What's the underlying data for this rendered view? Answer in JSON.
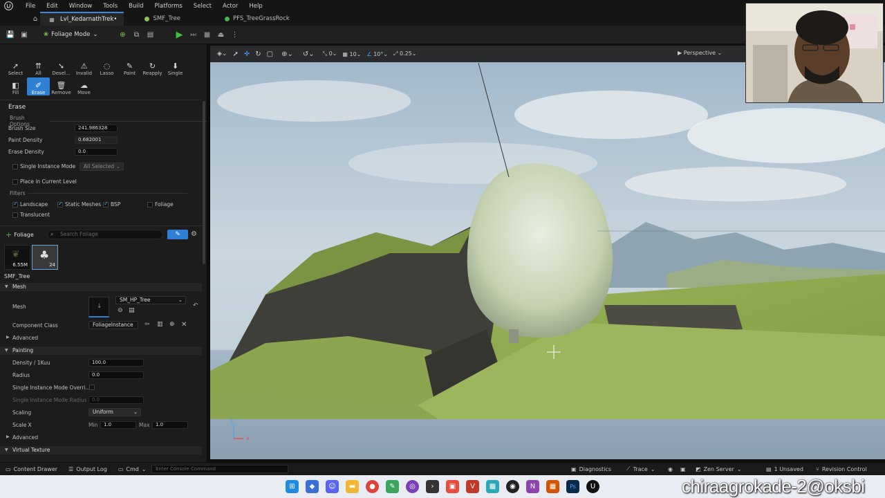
{
  "menubar": {
    "items": [
      "File",
      "Edit",
      "Window",
      "Tools",
      "Build",
      "Select",
      "Actor",
      "Help"
    ],
    "platforms": "Platforms"
  },
  "tabs": [
    {
      "label": "Lvl_KedarnathTrek•"
    },
    {
      "label": "SMF_Tree"
    },
    {
      "label": "PFS_TreeGrassRock"
    }
  ],
  "toolbar": {
    "mode_label": "Foliage Mode"
  },
  "tools": {
    "row1": [
      "Select",
      "All",
      "Desel...",
      "Invalid",
      "Lasso",
      "Paint",
      "Reapply",
      "Single"
    ],
    "row2": [
      "Fill",
      "Erase",
      "Remove",
      "Move"
    ],
    "active": "Erase"
  },
  "erase": {
    "title": "Erase",
    "brush_options": "Brush Options",
    "brush_size_label": "Brush Size",
    "brush_size": "241.986328",
    "paint_density_label": "Paint Density",
    "paint_density": "0.682001",
    "erase_density_label": "Erase Density",
    "erase_density": "0.0",
    "single_instance_label": "Single Instance Mode",
    "single_instance_value": "All Selected",
    "place_current_level": "Place in Current Level",
    "filters": "Filters",
    "filter_landscape": "Landscape",
    "filter_static_meshes": "Static Meshes",
    "filter_bsp": "BSP",
    "filter_foliage": "Foliage",
    "filter_translucent": "Translucent"
  },
  "foliage": {
    "add_label": "Foliage",
    "search_placeholder": "Search Foliage",
    "thumb1_count": "6.55M",
    "thumb2_count": "24",
    "selected_name": "SMF_Tree"
  },
  "details": {
    "mesh_cat": "Mesh",
    "mesh_label": "Mesh",
    "mesh_value": "SM_HP_Tree",
    "component_class_label": "Component Class",
    "component_class_value": "FoliageInstance",
    "advanced1": "Advanced",
    "painting_cat": "Painting",
    "density_label": "Density / 1Kuu",
    "density_value": "100.0",
    "radius_label": "Radius",
    "radius_value": "0.0",
    "sim_override_label": "Single Instance Mode Overri...",
    "sim_radius_label": "Single Instance Mode Radius",
    "sim_radius_value": "0.0",
    "scaling_label": "Scaling",
    "scaling_value": "Uniform",
    "scale_x_label": "Scale X",
    "min_label": "Min",
    "min_value": "1.0",
    "max_label": "Max",
    "max_value": "1.0",
    "advanced2": "Advanced",
    "virtual_texture_cat": "Virtual Texture"
  },
  "viewport": {
    "perspective": "Perspective",
    "grid_value": "10",
    "rot_value": "10°",
    "scale_value": "0.25",
    "snap_value": "0",
    "axis_z": "z",
    "axis_x": "x"
  },
  "bottombar": {
    "content_drawer": "Content Drawer",
    "output_log": "Output Log",
    "cmd": "Cmd",
    "console_placeholder": "Enter Console Command",
    "diagnostics": "Diagnostics",
    "trace": "Trace",
    "zen_server": "Zen Server",
    "unsaved": "1 Unsaved",
    "revision_control": "Revision Control"
  },
  "watermark": "chiraagrokade-2@oksbi",
  "colors": {
    "accent": "#2f7fd4",
    "play_green": "#3fbf3f"
  }
}
